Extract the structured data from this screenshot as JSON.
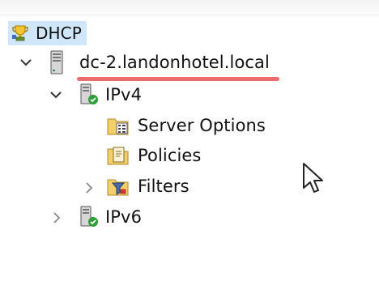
{
  "tree": {
    "root": {
      "label": "DHCP",
      "icon": "dhcp-trophy-icon"
    },
    "server": {
      "label": "dc-2.landonhotel.local",
      "icon": "server-icon",
      "expanded": true
    },
    "ipv4": {
      "label": "IPv4",
      "icon": "ipv4-server-check-icon",
      "expanded": true
    },
    "ipv4_children": [
      {
        "label": "Server Options",
        "icon": "server-options-icon"
      },
      {
        "label": "Policies",
        "icon": "policies-icon"
      },
      {
        "label": "Filters",
        "icon": "filters-icon",
        "expanded": false
      }
    ],
    "ipv6": {
      "label": "IPv6",
      "icon": "ipv6-server-check-icon",
      "expanded": false
    }
  },
  "colors": {
    "selection": "#cfe6fb",
    "annotation_underline": "#ef6c6c"
  }
}
